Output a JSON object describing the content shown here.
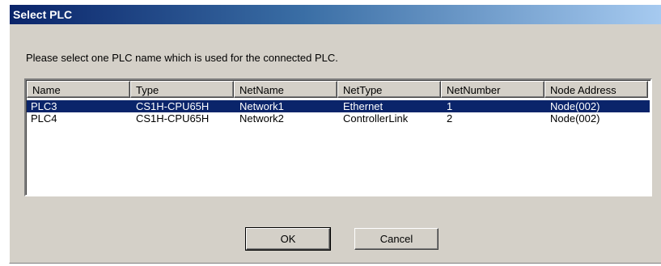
{
  "window": {
    "title": "Select PLC"
  },
  "prompt": "Please select one PLC name which is used for the connected PLC.",
  "table": {
    "columns": [
      "Name",
      "Type",
      "NetName",
      "NetType",
      "NetNumber",
      "Node Address"
    ],
    "rows": [
      [
        "PLC3",
        "CS1H-CPU65H",
        "Network1",
        "Ethernet",
        "1",
        "Node(002)"
      ],
      [
        "PLC4",
        "CS1H-CPU65H",
        "Network2",
        "ControllerLink",
        "2",
        "Node(002)"
      ]
    ],
    "selected_row": 0
  },
  "buttons": {
    "ok": "OK",
    "cancel": "Cancel"
  },
  "colors": {
    "selection": "#0a246a",
    "dialog_face": "#d4d0c8",
    "title_gradient_start": "#0a246a",
    "title_gradient_end": "#a6caf0"
  }
}
